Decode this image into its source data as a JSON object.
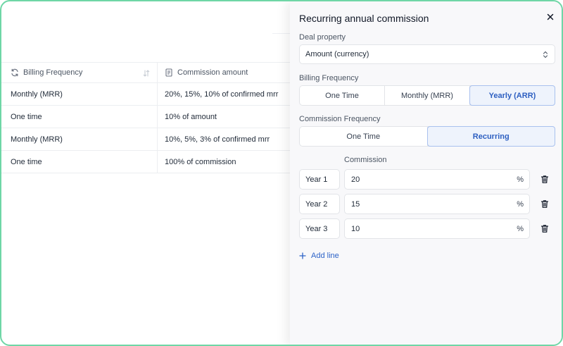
{
  "table": {
    "headers": [
      {
        "label": "Billing Frequency",
        "icon": "refresh-icon"
      },
      {
        "label": "Commission amount",
        "icon": "document-icon"
      }
    ],
    "rows": [
      {
        "billing": "Monthly (MRR)",
        "commission": "20%, 15%, 10% of confirmed mrr"
      },
      {
        "billing": "One time",
        "commission": "10% of amount"
      },
      {
        "billing": "Monthly (MRR)",
        "commission": "10%, 5%, 3% of confirmed mrr"
      },
      {
        "billing": "One time",
        "commission": "100% of commission"
      }
    ]
  },
  "panel": {
    "title": "Recurring annual commission",
    "deal_property": {
      "label": "Deal property",
      "value": "Amount (currency)"
    },
    "billing_frequency": {
      "label": "Billing Frequency",
      "options": [
        "One Time",
        "Monthly (MRR)",
        "Yearly (ARR)"
      ],
      "selected": "Yearly (ARR)"
    },
    "commission_frequency": {
      "label": "Commission Frequency",
      "options": [
        "One Time",
        "Recurring"
      ],
      "selected": "Recurring"
    },
    "commission_label": "Commission",
    "lines": [
      {
        "year": "Year 1",
        "value": "20",
        "unit": "%"
      },
      {
        "year": "Year 2",
        "value": "15",
        "unit": "%"
      },
      {
        "year": "Year 3",
        "value": "10",
        "unit": "%"
      }
    ],
    "add_line": "Add line"
  },
  "colors": {
    "accent": "#2d63c8",
    "frame": "#6fd6a6",
    "active_bg": "#eef3fc"
  }
}
